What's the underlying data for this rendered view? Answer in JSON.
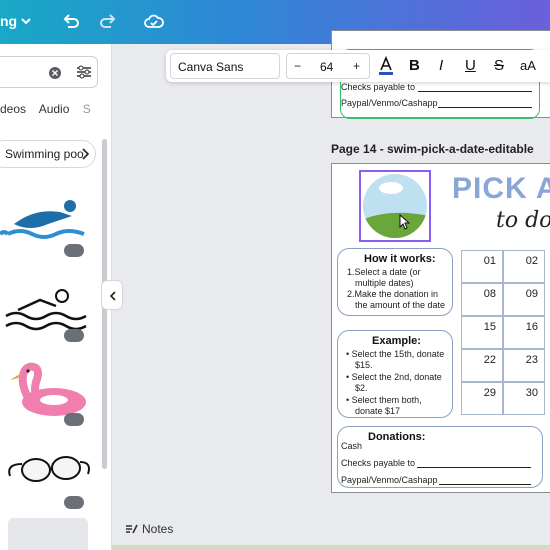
{
  "topbar": {
    "menu_label": "ng",
    "accent": "#2f86d6"
  },
  "panel": {
    "tabs": [
      "deos",
      "Audio",
      "S"
    ],
    "chip_label": "Swimming poo",
    "icons": [
      "search-icon",
      "clear-icon",
      "filter-icon"
    ]
  },
  "toolbar": {
    "font": "Canva Sans",
    "size_minus": "−",
    "size": "64",
    "size_plus": "+",
    "bold": "B",
    "italic": "I",
    "underline": "U",
    "strike": "S",
    "case": "aA"
  },
  "prev_page": {
    "checks_label": "Checks payable to",
    "paypal_label": "Paypal/Venmo/Cashapp"
  },
  "page": {
    "header": "Page 14 - swim-pick-a-date-editable",
    "title_line1": "PICK A",
    "title_line2": "to do",
    "how": {
      "title": "How it works:",
      "steps": [
        "1.Select a date (or",
        "multiple dates)",
        "2.Make the donation in",
        "the amount of the date"
      ]
    },
    "example": {
      "title": "Example:",
      "items": [
        "• Select the 15th, donate",
        "$15.",
        "• Select the 2nd, donate",
        "$2.",
        "• Select them both,",
        "donate $17"
      ]
    },
    "donations": {
      "title": "Donations:",
      "cash": "Cash",
      "checks": "Checks payable to",
      "paypal": "Paypal/Venmo/Cashapp"
    },
    "calendar": [
      [
        "01",
        "02"
      ],
      [
        "08",
        "09"
      ],
      [
        "",
        "15",
        "16"
      ],
      [
        "22",
        "23"
      ],
      [
        "29",
        "30"
      ]
    ],
    "cells_col1": [
      "01",
      "08",
      "15",
      "22",
      "29"
    ],
    "cells_col2": [
      "02",
      "09",
      "16",
      "23",
      "30"
    ]
  },
  "notes_label": "Notes"
}
